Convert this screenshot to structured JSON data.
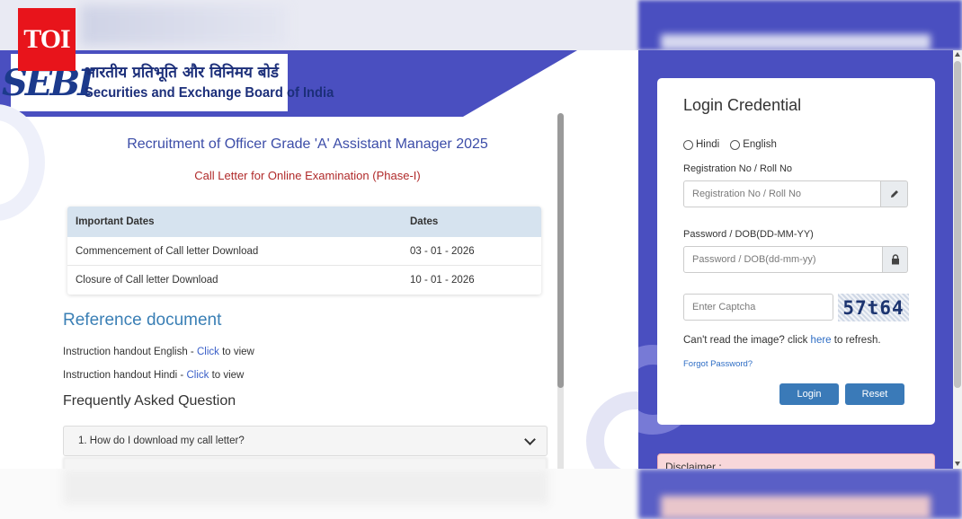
{
  "brand": {
    "toi": "TOI"
  },
  "logo": {
    "mark": "SEBI",
    "hindi": "भारतीय प्रतिभूति और विनिमय बोर्ड",
    "english": "Securities and Exchange Board of India"
  },
  "main": {
    "title": "Recruitment of Officer Grade 'A' Assistant Manager 2025",
    "subtitle": "Call Letter for Online Examination (Phase-I)",
    "dates_table": {
      "headers": [
        "Important Dates",
        "Dates"
      ],
      "rows": [
        [
          "Commencement of Call letter Download",
          "03 - 01 - 2026"
        ],
        [
          "Closure of Call letter Download",
          "10 - 01 - 2026"
        ]
      ]
    },
    "reference": {
      "title": "Reference document",
      "items": [
        {
          "prefix": "Instruction handout English - ",
          "link": "Click",
          "suffix": " to view"
        },
        {
          "prefix": "Instruction handout Hindi - ",
          "link": "Click",
          "suffix": " to view"
        }
      ]
    },
    "faq": {
      "title": "Frequently Asked Question",
      "items": [
        "1. How do I download my call letter?"
      ]
    }
  },
  "login": {
    "title": "Login Credential",
    "languages": [
      "Hindi",
      "English"
    ],
    "reg_label": "Registration No / Roll No",
    "reg_placeholder": "Registration No / Roll No",
    "pwd_label": "Password / DOB(DD-MM-YY)",
    "pwd_placeholder": "Password / DOB(dd-mm-yy)",
    "captcha_placeholder": "Enter Captcha",
    "captcha_text": "57t64",
    "refresh_prefix": "Can't read the image? click ",
    "refresh_link": "here",
    "refresh_suffix": " to refresh.",
    "forgot": "Forgot Password?",
    "login_button": "Login",
    "reset_button": "Reset",
    "disclaimer": "Disclaimer :"
  },
  "colors": {
    "brand_blue": "#4a4fc0",
    "title_blue": "#3c4da8",
    "subtitle_red": "#b02a2a",
    "button_blue": "#3a7ab8",
    "toi_red": "#e8141b"
  }
}
